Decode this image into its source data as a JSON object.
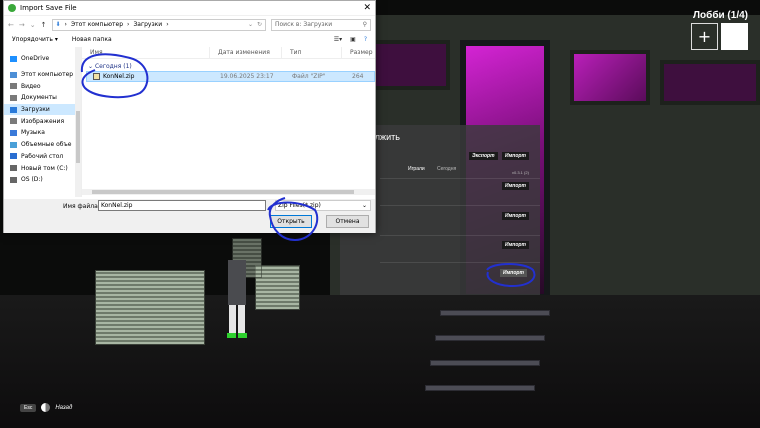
{
  "dialog": {
    "title": "Import Save File",
    "close_glyph": "✕",
    "nav": {
      "back": "←",
      "forward": "→",
      "up": "↑",
      "recent": "⌄"
    },
    "address": {
      "path1": "Этот компьютер",
      "path2": "Загрузки",
      "sep": "›"
    },
    "search_placeholder": "Поиск в: Загрузки",
    "toolbar": {
      "organize": "Упорядочить ▾",
      "new_folder": "Новая папка"
    },
    "nav_items": [
      {
        "label": "OneDrive",
        "icon": "cloud-icon",
        "color": "#1e90ff"
      },
      {
        "label": "Этот компьютер",
        "icon": "computer-icon",
        "color": "#4d8fd6"
      },
      {
        "label": "Видео",
        "icon": "video-icon",
        "color": "#7a7a7a"
      },
      {
        "label": "Документы",
        "icon": "documents-icon",
        "color": "#7a7a7a"
      },
      {
        "label": "Загрузки",
        "icon": "download-icon",
        "color": "#2a7ad9"
      },
      {
        "label": "Изображения",
        "icon": "pictures-icon",
        "color": "#7a7a7a"
      },
      {
        "label": "Музыка",
        "icon": "music-icon",
        "color": "#3a7ad9"
      },
      {
        "label": "Объемные объе",
        "icon": "3d-objects-icon",
        "color": "#4aa0d8"
      },
      {
        "label": "Рабочий стол",
        "icon": "desktop-icon",
        "color": "#2a6ed1"
      },
      {
        "label": "Новый том (C:)",
        "icon": "drive-icon",
        "color": "#666666"
      },
      {
        "label": "OS (D:)",
        "icon": "drive-icon",
        "color": "#666666"
      }
    ],
    "selected_nav": "Загрузки",
    "columns": {
      "name": "Имя",
      "date": "Дата изменения",
      "type": "Тип",
      "size": "Размер"
    },
    "group": "Сегодня (1)",
    "file": {
      "name": "KonNel.zip",
      "date": "19.06.2025 23:17",
      "type": "Файл \"ZIP\"",
      "size": "264"
    },
    "filename_label": "Имя файла:",
    "filename_value": "KonNel.zip",
    "filetype_value": "Zip Files(*.zip)",
    "open_button": "Открыть",
    "cancel_button": "Отмена"
  },
  "game": {
    "lobby_label": "Лобби (1/4)",
    "add_glyph": "+",
    "panel_title": "олжить",
    "export_label": "Экспорт",
    "import_label": "Импорт",
    "games_label": "Играли",
    "today_label": "Сегодня",
    "version_label": "v0.3.1 (2)",
    "esc_key": "Esc",
    "back_label": "Назад",
    "accent_color": "#c824c8"
  }
}
